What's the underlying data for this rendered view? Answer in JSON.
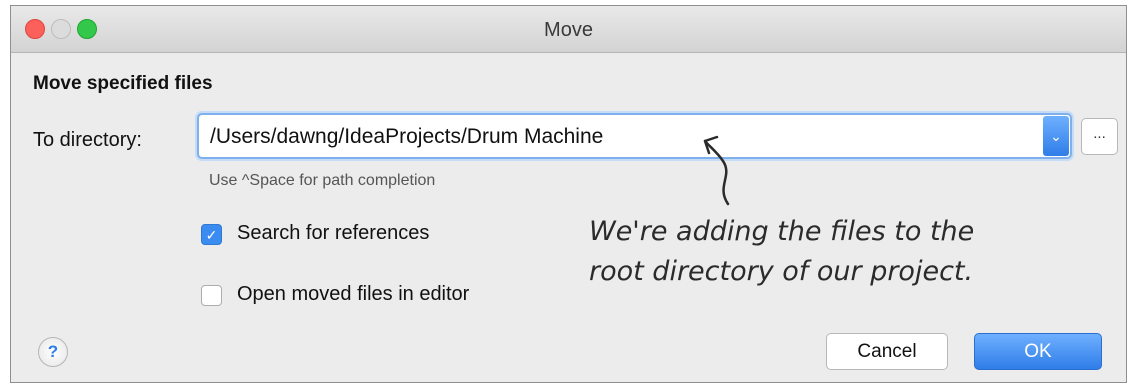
{
  "window": {
    "title": "Move",
    "controls": [
      "close",
      "minimize",
      "zoom"
    ]
  },
  "dialog": {
    "heading": "Move specified files",
    "to_directory": {
      "label": "To directory:",
      "value": "/Users/dawng/IdeaProjects/Drum Machine",
      "dropdown_icon": "chevron-down-icon",
      "browse_label": "..."
    },
    "hint": "Use ^Space for path completion",
    "options": [
      {
        "label": "Search for references",
        "checked": true
      },
      {
        "label": "Open moved files in editor",
        "checked": false
      }
    ],
    "help_label": "?",
    "buttons": {
      "cancel": "Cancel",
      "ok": "OK"
    }
  },
  "annotation": {
    "line1": "We're adding the files to the",
    "line2": "root directory of our project."
  },
  "colors": {
    "accent": "#2f7de8",
    "focus_ring": "#7fb0ec",
    "close": "#fc605b",
    "zoom": "#34c84a"
  }
}
